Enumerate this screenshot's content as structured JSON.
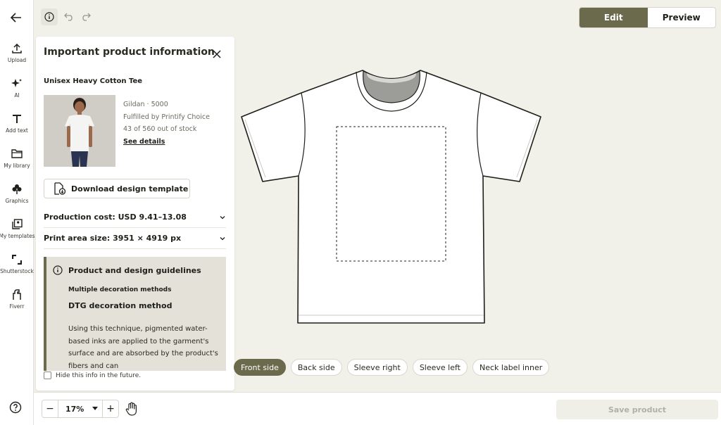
{
  "topbar": {
    "edit_label": "Edit",
    "preview_label": "Preview"
  },
  "rail": {
    "items": [
      {
        "label": "Upload",
        "icon": "upload-icon"
      },
      {
        "label": "AI",
        "icon": "sparkle-icon"
      },
      {
        "label": "Add text",
        "icon": "text-icon"
      },
      {
        "label": "My library",
        "icon": "folder-icon"
      },
      {
        "label": "Graphics",
        "icon": "graphics-icon"
      },
      {
        "label": "My templates",
        "icon": "templates-icon"
      },
      {
        "label": "Shutterstock",
        "icon": "shutterstock-icon"
      },
      {
        "label": "Fiverr",
        "icon": "fiverr-icon"
      }
    ]
  },
  "panel": {
    "title": "Important product information",
    "product_name": "Unisex Heavy Cotton Tee",
    "brand": "Gildan · 5000",
    "fulfilled": "Fulfilled by Printify Choice",
    "stock": "43 of 560 out of stock",
    "details_link": "See details",
    "download_label": "Download design template",
    "production_cost": "Production cost: USD 9.41–13.08",
    "print_area": "Print area size: 3951 × 4919 px",
    "guidelines_title": "Product and design guidelines",
    "guidelines_sub": "Multiple decoration methods",
    "method_title": "DTG decoration method",
    "method_body": "Using this technique, pigmented water-based inks are applied to the garment's surface and are absorbed by the product's fibers and can",
    "hide_label": "Hide this info in the future."
  },
  "sides": [
    "Front side",
    "Back side",
    "Sleeve right",
    "Sleeve left",
    "Neck label inner"
  ],
  "zoom": {
    "minus": "−",
    "value": "17%",
    "plus": "+"
  },
  "save_label": "Save product",
  "colors": {
    "accent": "#6b6a4c",
    "background": "#f1f0e9",
    "guideline_bg": "#e3e1d8"
  }
}
